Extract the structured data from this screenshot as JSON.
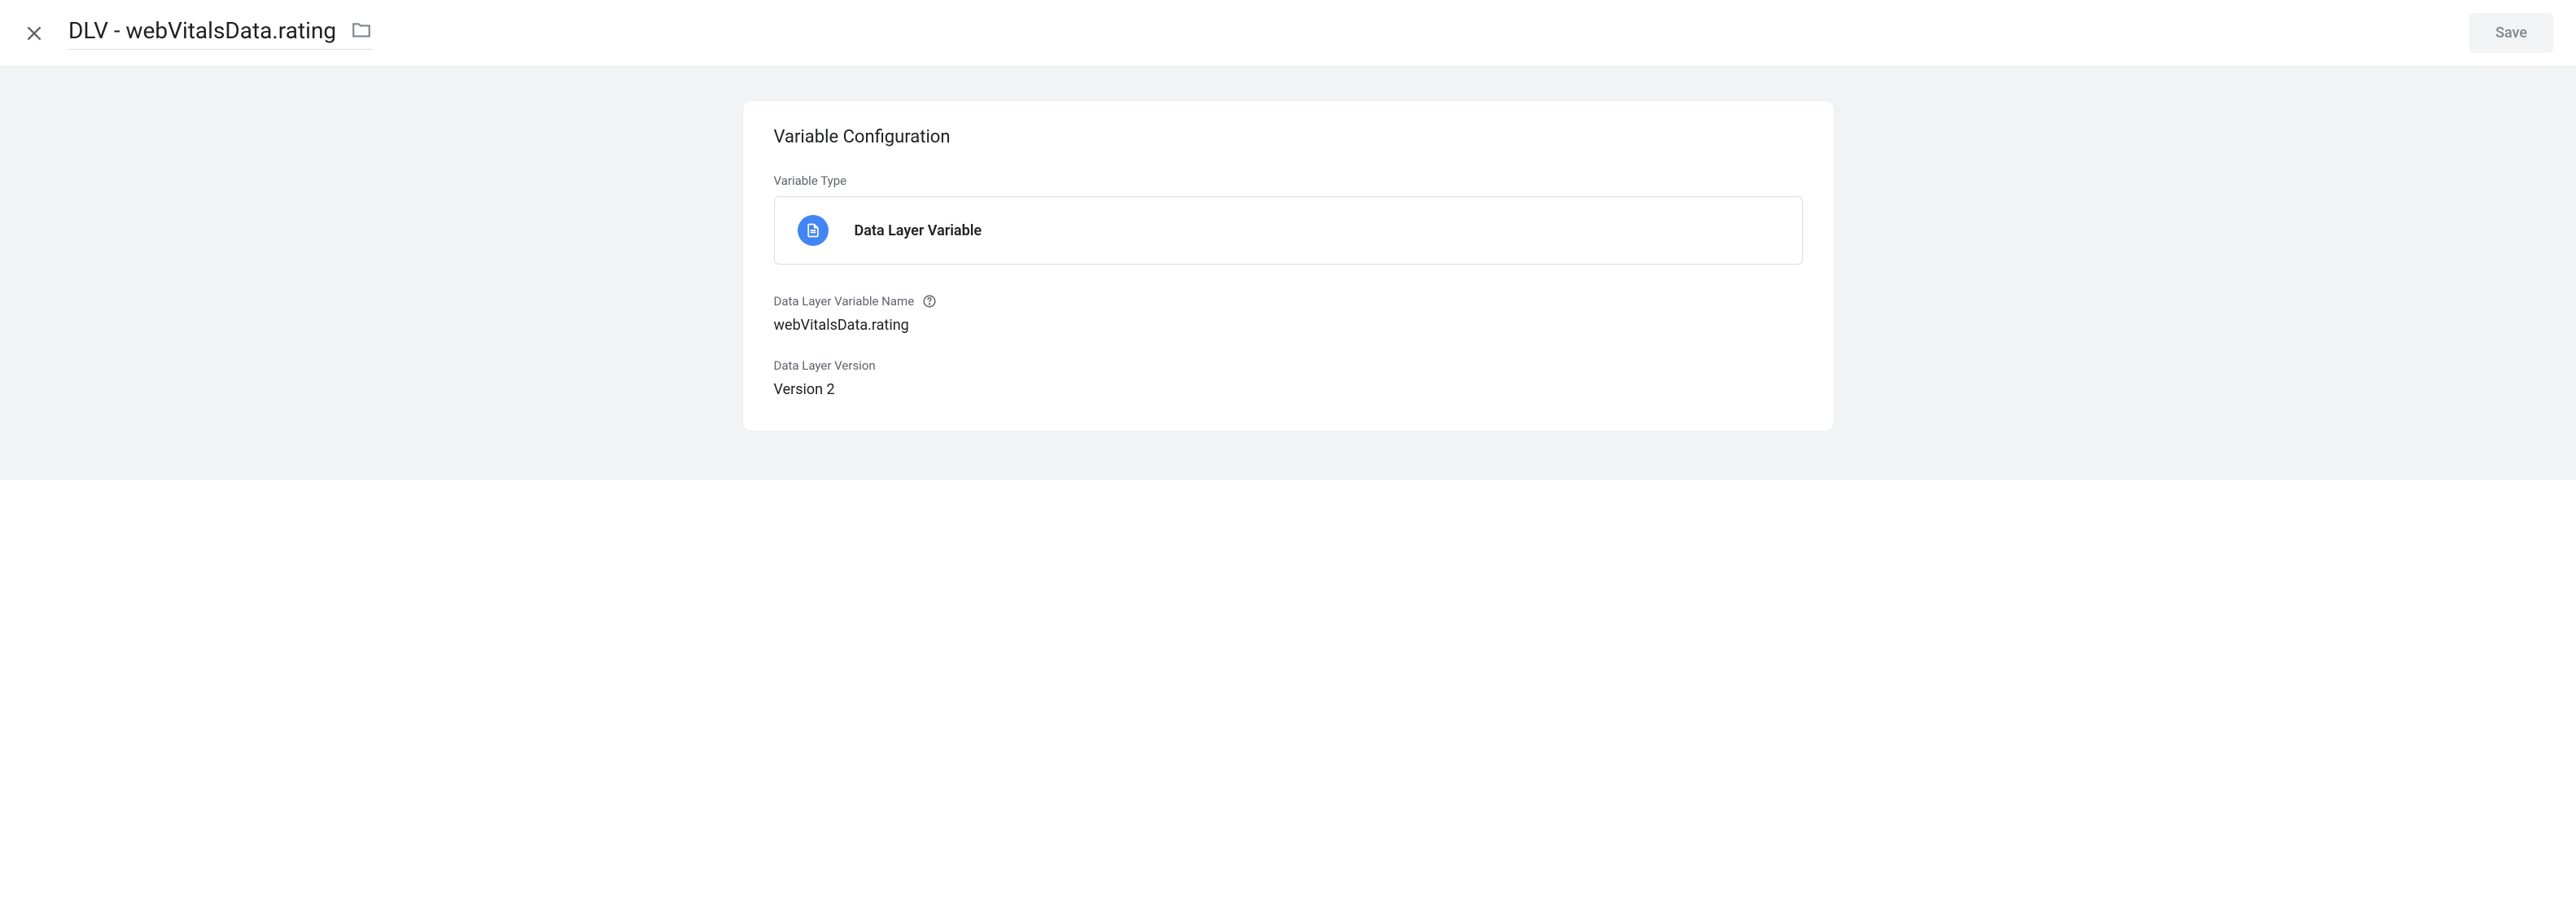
{
  "header": {
    "title": "DLV - webVitalsData.rating",
    "save_label": "Save"
  },
  "card": {
    "title": "Variable Configuration",
    "type_label": "Variable Type",
    "type_value": "Data Layer Variable",
    "name_label": "Data Layer Variable Name",
    "name_value": "webVitalsData.rating",
    "version_label": "Data Layer Version",
    "version_value": "Version 2"
  }
}
